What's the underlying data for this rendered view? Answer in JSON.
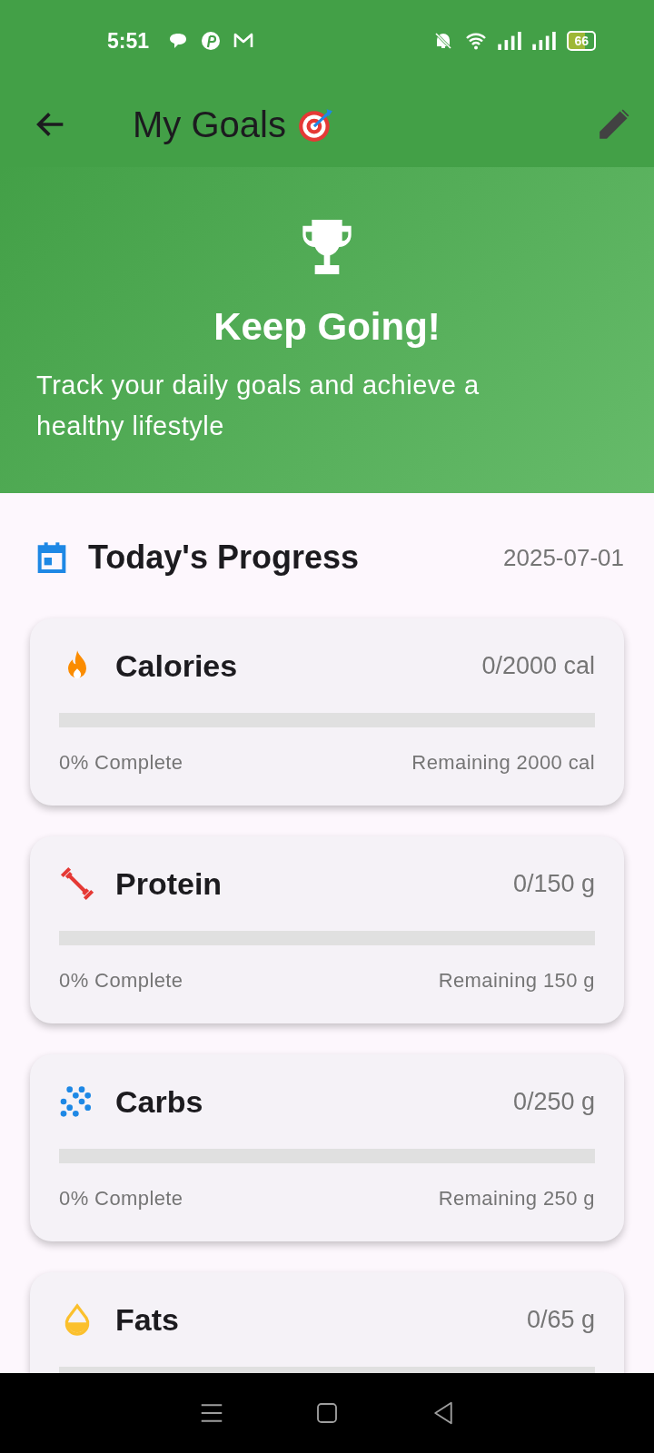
{
  "status_bar": {
    "time": "5:51",
    "battery": "66"
  },
  "app_bar": {
    "title": "My Goals"
  },
  "hero": {
    "title": "Keep Going!",
    "subtitle": "Track your daily goals and achieve a healthy lifestyle"
  },
  "section": {
    "title": "Today's Progress",
    "date": "2025-07-01"
  },
  "goals": [
    {
      "kind": "flame",
      "color": "#fb8c00",
      "name": "Calories",
      "value": "0/2000 cal",
      "level": 0,
      "complete": "0% Complete",
      "remaining": "Remaining 2000 cal"
    },
    {
      "kind": "dumbbell",
      "color": "#e53935",
      "name": "Protein",
      "value": "0/150 g",
      "level": 0,
      "complete": "0% Complete",
      "remaining": "Remaining 150 g"
    },
    {
      "kind": "grain",
      "color": "#1e88e5",
      "name": "Carbs",
      "value": "0/250 g",
      "level": 0,
      "complete": "0% Complete",
      "remaining": "Remaining 250 g"
    },
    {
      "kind": "drop",
      "color": "#fbc02d",
      "name": "Fats",
      "value": "0/65 g",
      "level": 0
    }
  ]
}
